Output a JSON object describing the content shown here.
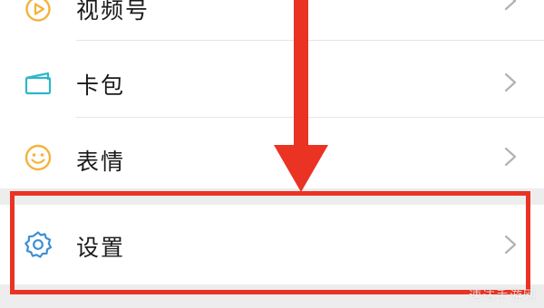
{
  "menu": {
    "items": [
      {
        "label": "视频号",
        "icon": "video-channel-icon",
        "icon_color": "#f3b33a"
      },
      {
        "label": "卡包",
        "icon": "card-wallet-icon",
        "icon_color": "#2eb6c8"
      },
      {
        "label": "表情",
        "icon": "emoji-icon",
        "icon_color": "#f3b33a"
      }
    ],
    "settings": {
      "label": "设置",
      "icon": "gear-icon",
      "icon_color": "#3b8fd6"
    }
  },
  "annotation": {
    "color": "#ea3323",
    "arrow": "down-arrow-icon"
  },
  "watermark": {
    "text": "速达手游网"
  },
  "colors": {
    "background": "#ededed",
    "row": "#ffffff",
    "text": "#1a1a1a",
    "chevron": "#b2b2b2"
  }
}
